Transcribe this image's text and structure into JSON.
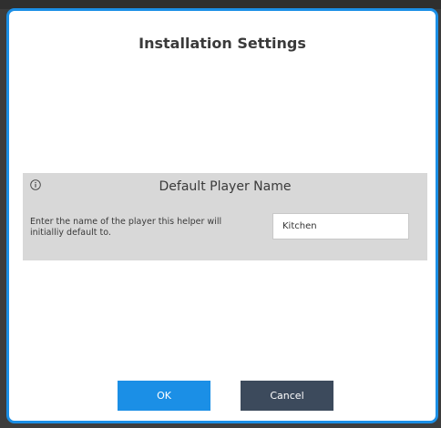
{
  "dialog": {
    "title": "Installation Settings",
    "accent_color": "#1b8fe6"
  },
  "setting": {
    "icon": "info-icon",
    "title": "Default Player Name",
    "description": "Enter the name of the player this helper will initialliy default to.",
    "input_value": "Kitchen",
    "panel_color": "#d8d8d8"
  },
  "buttons": {
    "ok_label": "OK",
    "cancel_label": "Cancel",
    "ok_color": "#1b8fe6",
    "cancel_color": "#3c4a5c"
  }
}
